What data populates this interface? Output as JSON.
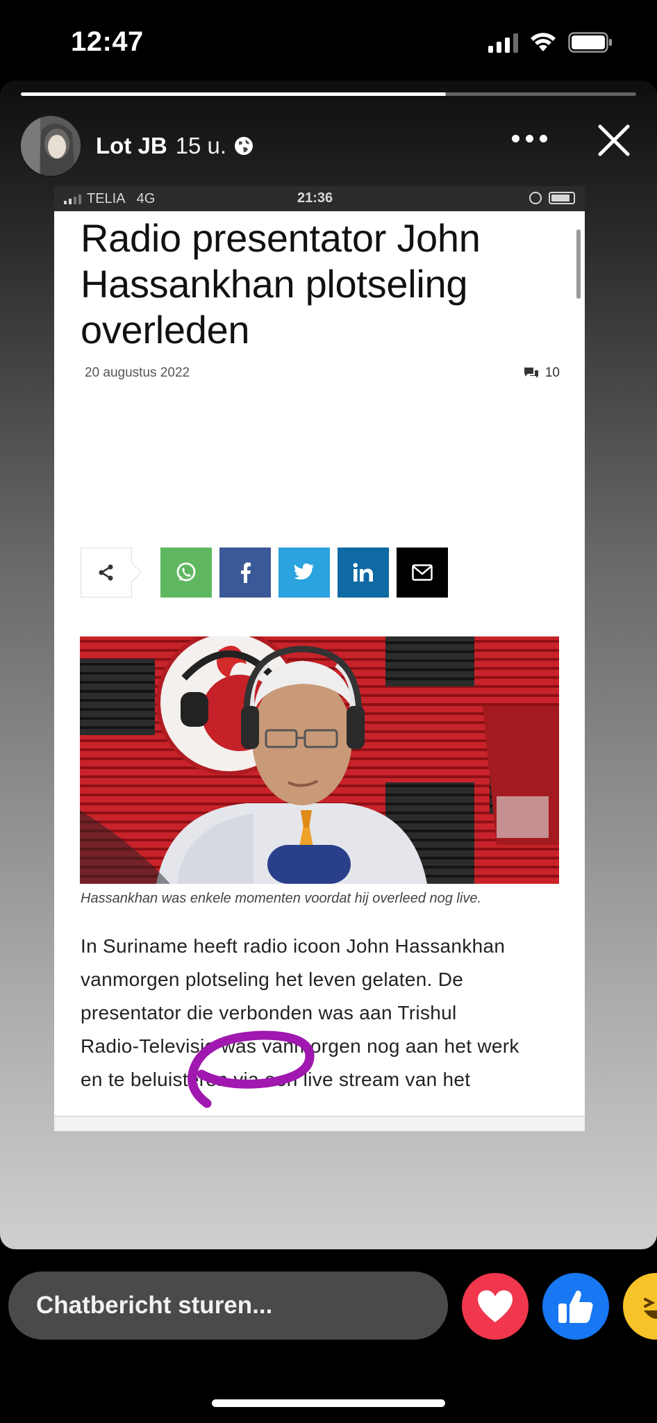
{
  "status_bar": {
    "time": "12:47",
    "icons": [
      "cellular-signal-icon",
      "wifi-icon",
      "battery-icon"
    ]
  },
  "story": {
    "progress_segments_total": 3,
    "progress_fraction": 0.69,
    "user_name": "Lot JB",
    "post_time": "15 u.",
    "audience_icon": "globe-icon",
    "more_icon": "more-dots-icon",
    "close_icon": "close-icon"
  },
  "screenshot": {
    "status": {
      "carrier": "TELIA",
      "network": "4G",
      "time": "21:36"
    },
    "headline": "Radio presentator John Hassankhan plotseling overleden",
    "date": "20 augustus 2022",
    "comment_count": "10",
    "share_icons": [
      "share-icon",
      "whatsapp-icon",
      "facebook-icon",
      "twitter-icon",
      "linkedin-icon",
      "email-icon"
    ],
    "share_colors": {
      "whatsapp": "#5fb85f",
      "facebook": "#3b5998",
      "twitter": "#2aa3df",
      "linkedin": "#0f6aa3",
      "email": "#000000"
    },
    "caption": "Hassankhan was enkele momenten voordat hij overleed nog live.",
    "body_lines": [
      "In Suriname heeft radio icoon John Hassankhan",
      "vanmorgen plotseling het leven gelaten. De",
      "presentator die verbonden was aan Trishul",
      "Radio-Televisie was vanmorgen nog aan het werk",
      "en te beluisteren via een live stream van het"
    ],
    "annotation_color": "#a018b0"
  },
  "reply": {
    "placeholder": "Chatbericht sturen...",
    "reactions": [
      "heart-reaction-icon",
      "like-reaction-icon",
      "haha-reaction-icon"
    ]
  }
}
